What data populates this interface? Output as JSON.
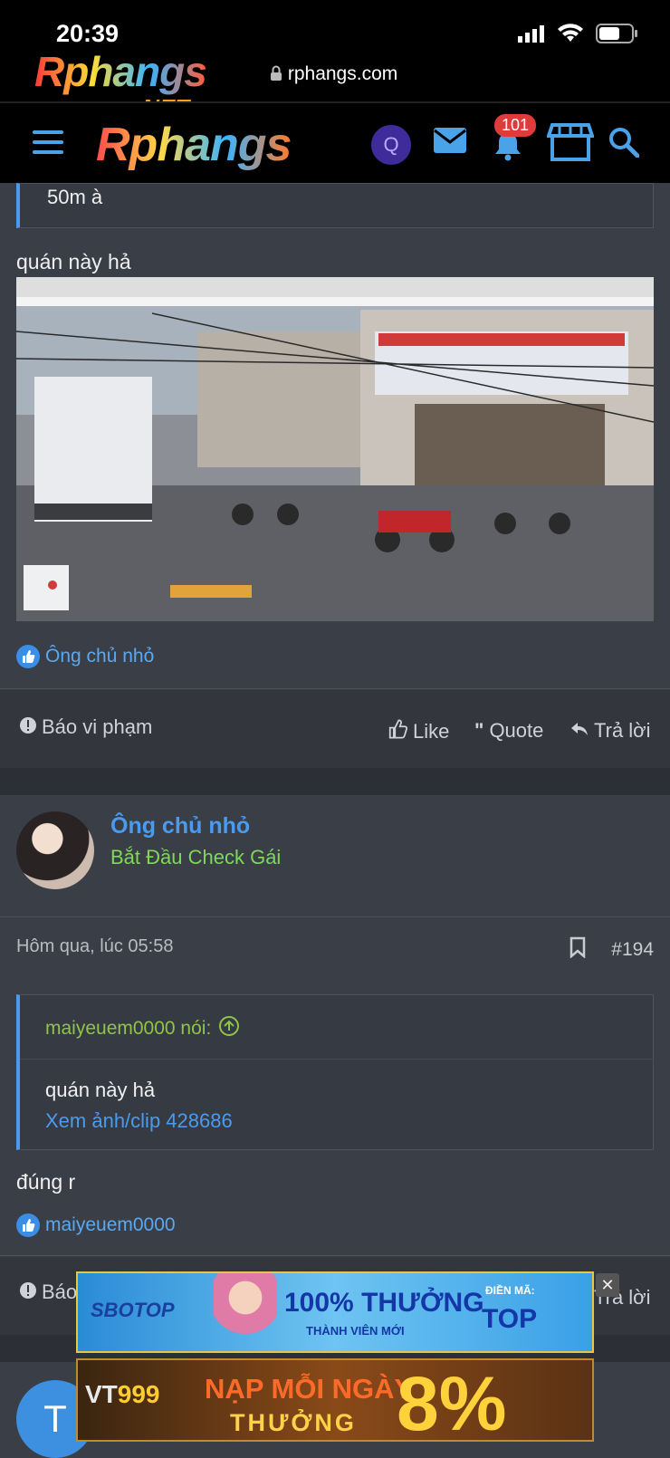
{
  "status_bar": {
    "time": "20:39",
    "url": "rphangs.com"
  },
  "header": {
    "logo_small": "Rphangs",
    "logo_small_net": ".NET",
    "logo": "Rphangs",
    "avatar_letter": "Q",
    "notification_count": "101"
  },
  "post_193": {
    "quote_tail": "50m à",
    "text": "quán này hả",
    "liker": "Ông chủ nhỏ",
    "actions": {
      "report": "Báo vi phạm",
      "like": "Like",
      "quote": "Quote",
      "reply": "Trả lời"
    }
  },
  "post_194": {
    "author": "Ông chủ nhỏ",
    "author_title": "Bắt Đầu Check Gái",
    "timestamp": "Hôm qua, lúc 05:58",
    "number": "#194",
    "quote_author": "maiyeuem0000 nói:",
    "quote_text": "quán này hả",
    "quote_link": "Xem ảnh/clip 428686",
    "text": "đúng r",
    "liker": "maiyeuem0000",
    "actions": {
      "report": "Báo",
      "reply": "Trả lời"
    }
  },
  "next_post": {
    "avatar_letter": "T"
  },
  "ads": {
    "ad1": {
      "brand": "SBOTOP",
      "headline": "100% THƯỞNG",
      "subline": "THÀNH VIÊN MỚI",
      "code_label": "ĐIỀN MÃ:",
      "code": "TOP"
    },
    "ad2": {
      "brand_a": "VT",
      "brand_b": "999",
      "line1": "NẠP MỖI NGÀY",
      "line2": "THƯỞNG",
      "percent": "8%"
    },
    "close_symbol": "✕"
  },
  "colors": {
    "accent": "#4a9bf0",
    "title_green": "#7ed957",
    "quote_green": "#8fc34a",
    "badge_red": "#e03b3b"
  }
}
